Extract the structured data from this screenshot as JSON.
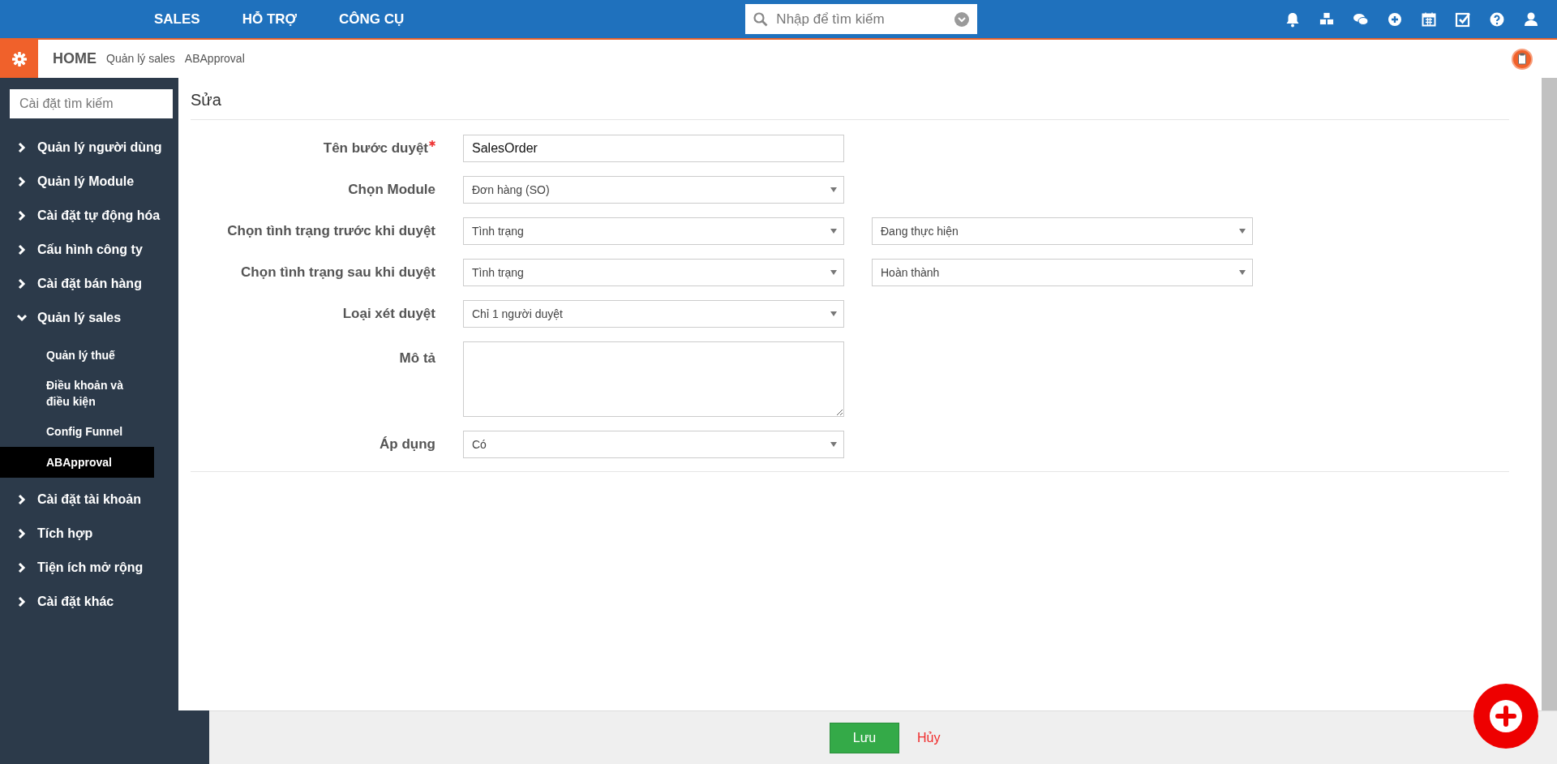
{
  "top_nav": {
    "menu": [
      "SALES",
      "HỖ TRỢ",
      "CÔNG CỤ"
    ],
    "search": {
      "placeholder": "Nhập để tìm kiếm"
    }
  },
  "breadcrumb": [
    "HOME",
    "Quản lý sales",
    "ABApproval"
  ],
  "sidebar": {
    "search": {
      "placeholder": "Cài đặt tìm kiếm"
    },
    "items": [
      {
        "label": "Quản lý người dùng",
        "expanded": false
      },
      {
        "label": "Quản lý Module",
        "expanded": false
      },
      {
        "label": "Cài đặt tự động hóa",
        "expanded": false
      },
      {
        "label": "Cấu hình công ty",
        "expanded": false
      },
      {
        "label": "Cài đặt bán hàng",
        "expanded": false
      },
      {
        "label": "Quản lý sales",
        "expanded": true,
        "children": [
          {
            "label": "Quản lý thuế",
            "selected": false
          },
          {
            "label": "Điều khoản và điều kiện",
            "selected": false
          },
          {
            "label": "Config Funnel",
            "selected": false
          },
          {
            "label": "ABApproval",
            "selected": true
          }
        ]
      },
      {
        "label": "Cài đặt tài khoản",
        "expanded": false
      },
      {
        "label": "Tích hợp",
        "expanded": false
      },
      {
        "label": "Tiện ích mở rộng",
        "expanded": false
      },
      {
        "label": "Cài đặt khác",
        "expanded": false
      }
    ]
  },
  "form": {
    "title": "Sửa",
    "fields": [
      {
        "kind": "text",
        "label": "Tên bước duyệt",
        "required": true,
        "value": "SalesOrder"
      },
      {
        "kind": "select",
        "label": "Chọn Module",
        "required": false,
        "values": [
          "Đơn hàng (SO)"
        ]
      },
      {
        "kind": "select",
        "label": "Chọn tình trạng trước khi duyệt",
        "required": false,
        "values": [
          "Tình trạng",
          "Đang thực hiện"
        ]
      },
      {
        "kind": "select",
        "label": "Chọn tình trạng sau khi duyệt",
        "required": false,
        "values": [
          "Tình trạng",
          "Hoàn thành"
        ]
      },
      {
        "kind": "select",
        "label": "Loại xét duyệt",
        "required": false,
        "values": [
          "Chỉ 1 người duyệt"
        ]
      },
      {
        "kind": "textarea",
        "label": "Mô tả",
        "required": false
      },
      {
        "kind": "select",
        "label": "Áp dụng",
        "required": false,
        "values": [
          "Có"
        ]
      }
    ]
  },
  "footer": {
    "save": "Lưu",
    "cancel": "Hủy"
  }
}
